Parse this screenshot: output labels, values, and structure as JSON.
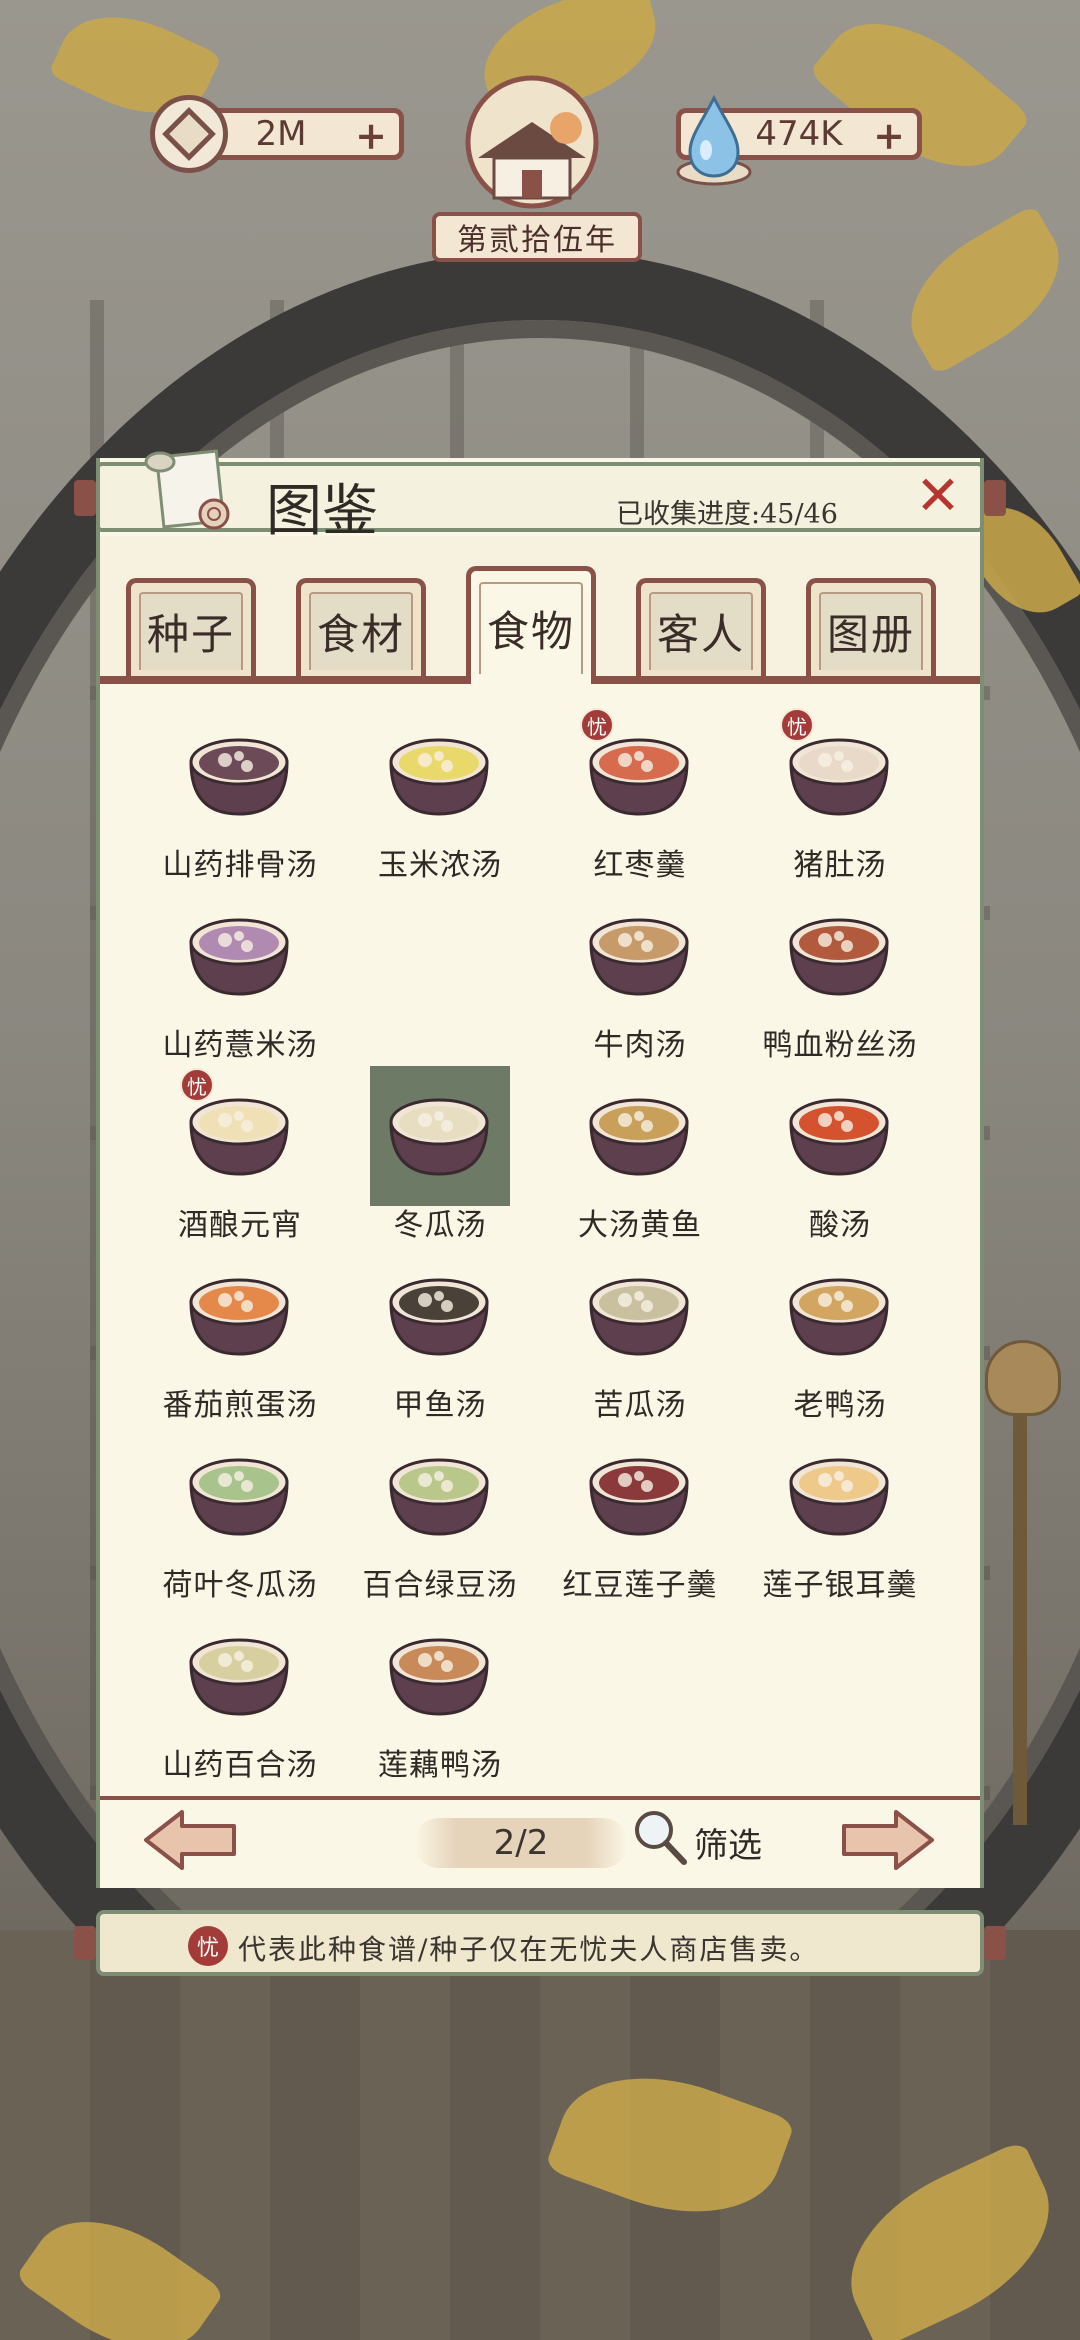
{
  "hud": {
    "coins": "2M",
    "gems": "474K",
    "plus": "+",
    "year": "第贰拾伍年"
  },
  "panel": {
    "title": "图鉴",
    "progress": "已收集进度:45/46",
    "close": "✕"
  },
  "tabs": [
    {
      "label": "种子",
      "active": false
    },
    {
      "label": "食材",
      "active": false
    },
    {
      "label": "食物",
      "active": true
    },
    {
      "label": "客人",
      "active": false
    },
    {
      "label": "图册",
      "active": false
    }
  ],
  "badge_char": "忧",
  "dishes": [
    {
      "name": "山药排骨汤",
      "badge": false,
      "color": "#6c4a58"
    },
    {
      "name": "玉米浓汤",
      "badge": false,
      "color": "#e9d86a"
    },
    {
      "name": "红枣羹",
      "badge": true,
      "color": "#d66b4e"
    },
    {
      "name": "猪肚汤",
      "badge": true,
      "color": "#e9d9c8"
    },
    {
      "name": "山药薏米汤",
      "badge": false,
      "color": "#b08ab0"
    },
    {
      "name": "",
      "badge": false,
      "locked": true
    },
    {
      "name": "牛肉汤",
      "badge": false,
      "color": "#c79a6a"
    },
    {
      "name": "鸭血粉丝汤",
      "badge": false,
      "color": "#b25a3e"
    },
    {
      "name": "酒酿元宵",
      "badge": true,
      "color": "#efe0b6"
    },
    {
      "name": "冬瓜汤",
      "badge": false,
      "color": "#e7ddc0"
    },
    {
      "name": "大汤黄鱼",
      "badge": false,
      "color": "#c8a05a"
    },
    {
      "name": "酸汤",
      "badge": false,
      "color": "#d4532e"
    },
    {
      "name": "番茄煎蛋汤",
      "badge": false,
      "color": "#e4894a"
    },
    {
      "name": "甲鱼汤",
      "badge": false,
      "color": "#4a4238"
    },
    {
      "name": "苦瓜汤",
      "badge": false,
      "color": "#c9c0a0"
    },
    {
      "name": "老鸭汤",
      "badge": false,
      "color": "#d2a560"
    },
    {
      "name": "荷叶冬瓜汤",
      "badge": false,
      "color": "#a8c48c"
    },
    {
      "name": "百合绿豆汤",
      "badge": false,
      "color": "#b9c88a"
    },
    {
      "name": "红豆莲子羹",
      "badge": false,
      "color": "#8a3a3a"
    },
    {
      "name": "莲子银耳羹",
      "badge": false,
      "color": "#eec98a"
    },
    {
      "name": "山药百合汤",
      "badge": false,
      "color": "#d8cfa0"
    },
    {
      "name": "莲藕鸭汤",
      "badge": false,
      "color": "#c98a5a"
    }
  ],
  "pagination": {
    "page": "2/2",
    "filter": "筛选"
  },
  "footer": {
    "note": "代表此种食谱/种子仅在无忧夫人商店售卖。"
  }
}
